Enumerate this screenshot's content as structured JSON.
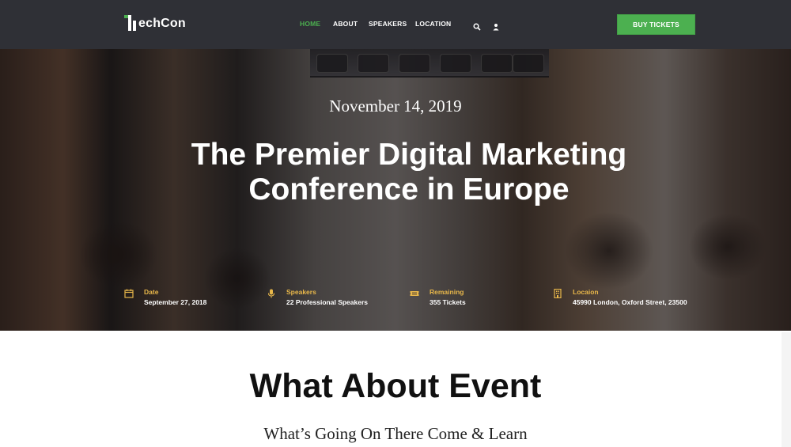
{
  "brand": {
    "logo_text": "echCon",
    "accent_color": "#4cb050"
  },
  "nav": {
    "links": [
      {
        "label": "HOME",
        "active": true
      },
      {
        "label": "ABOUT",
        "active": false
      },
      {
        "label": "SPEAKERS",
        "active": false
      },
      {
        "label": "LOCATION",
        "active": false
      }
    ],
    "icons": [
      "search-icon",
      "user-icon"
    ],
    "cta_label": "BUY TICKETS"
  },
  "hero": {
    "date": "November 14, 2019",
    "title": "The Premier Digital Marketing Conference in Europe",
    "info": [
      {
        "icon": "calendar-icon",
        "label": "Date",
        "value": "September 27, 2018"
      },
      {
        "icon": "microphone-icon",
        "label": "Speakers",
        "value": "22 Professional Speakers"
      },
      {
        "icon": "ticket-icon",
        "label": "Remaining",
        "value": "355 Tickets"
      },
      {
        "icon": "building-icon",
        "label": "Locaion",
        "value": "45990 London, Oxford Street, 23500"
      }
    ],
    "label_color": "#e8b74a"
  },
  "about": {
    "title": "What About Event",
    "subtitle": "What’s Going On There Come & Learn"
  }
}
